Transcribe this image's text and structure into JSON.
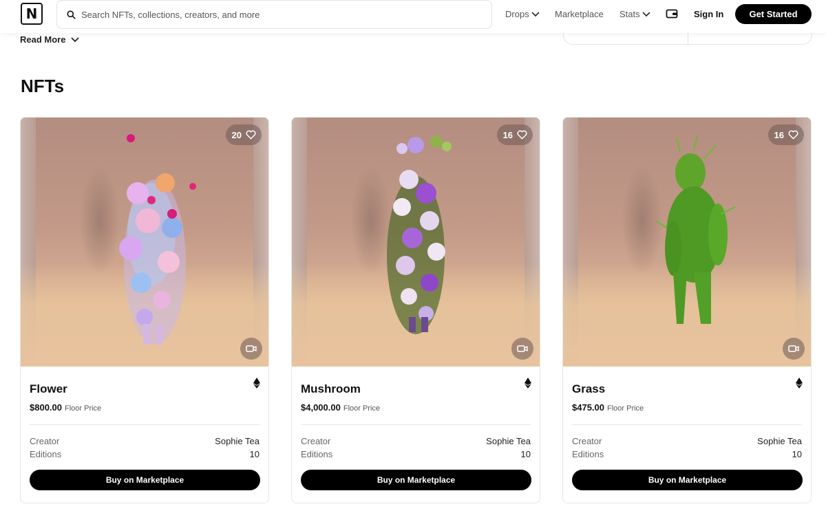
{
  "header": {
    "logo_letter": "N",
    "search_placeholder": "Search NFTs, collections, creators, and more",
    "nav": {
      "drops": "Drops",
      "marketplace": "Marketplace",
      "stats": "Stats"
    },
    "sign_in": "Sign In",
    "get_started": "Get Started"
  },
  "read_more": "Read More",
  "section_title": "NFTs",
  "labels": {
    "floor_price": "Floor Price",
    "creator": "Creator",
    "editions": "Editions",
    "buy": "Buy on Marketplace"
  },
  "cards": [
    {
      "title": "Flower",
      "price": "$800.00",
      "likes": "20",
      "creator": "Sophie Tea",
      "editions": "10"
    },
    {
      "title": "Mushroom",
      "price": "$4,000.00",
      "likes": "16",
      "creator": "Sophie Tea",
      "editions": "10"
    },
    {
      "title": "Grass",
      "price": "$475.00",
      "likes": "16",
      "creator": "Sophie Tea",
      "editions": "10"
    }
  ],
  "colors": {
    "primary_button": "#000000",
    "background": "#ffffff",
    "media_tone": "#c39a88"
  }
}
